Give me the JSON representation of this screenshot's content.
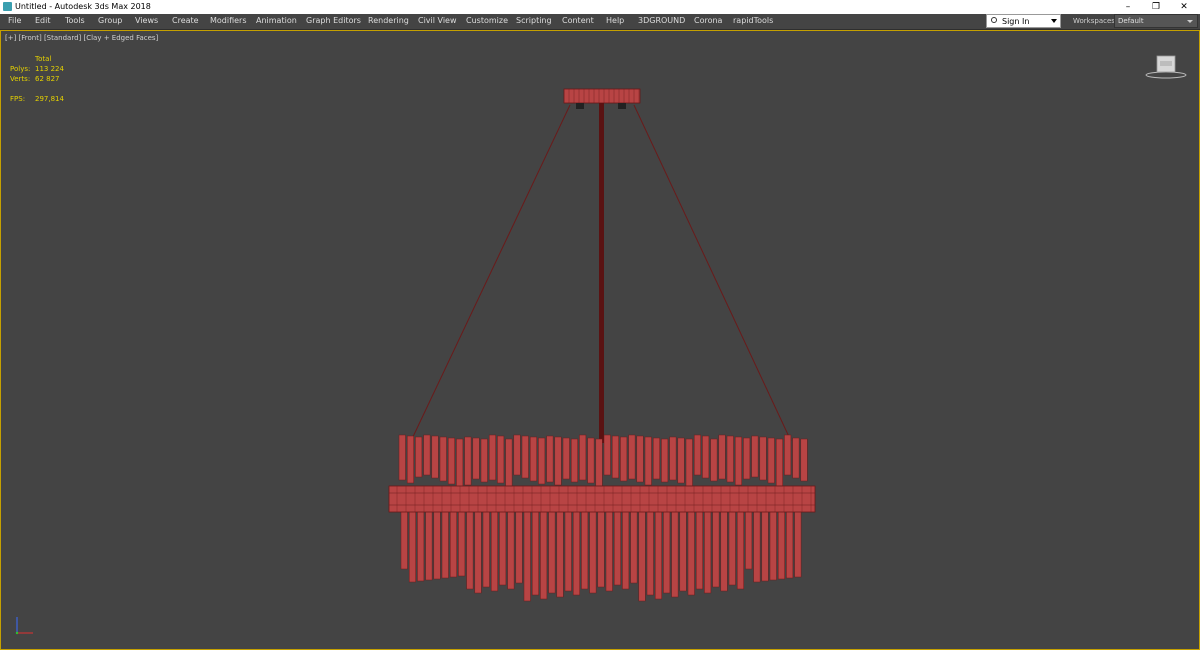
{
  "window": {
    "title": "Untitled - Autodesk 3ds Max 2018",
    "minimize_glyph": "–",
    "restore_glyph": "❐",
    "close_glyph": "✕"
  },
  "menu": {
    "items": [
      "File",
      "Edit",
      "Tools",
      "Group",
      "Views",
      "Create",
      "Modifiers",
      "Animation",
      "Graph Editors",
      "Rendering",
      "Civil View",
      "Customize",
      "Scripting",
      "Content",
      "Help",
      "3DGROUND",
      "Corona",
      "rapidTools"
    ]
  },
  "account": {
    "sign_in_label": "Sign In",
    "workspaces_label": "Workspaces:",
    "workspace_value": "Default"
  },
  "viewport": {
    "label": "[+] [Front] [Standard] [Clay + Edged Faces]",
    "stats": {
      "header": "Total",
      "polys_label": "Polys:",
      "polys_value": "113 224",
      "verts_label": "Verts:",
      "verts_value": "62 827",
      "fps_label": "FPS:",
      "fps_value": "297,814"
    },
    "model_color": "#b84444",
    "frame_color": "#c5a000"
  }
}
